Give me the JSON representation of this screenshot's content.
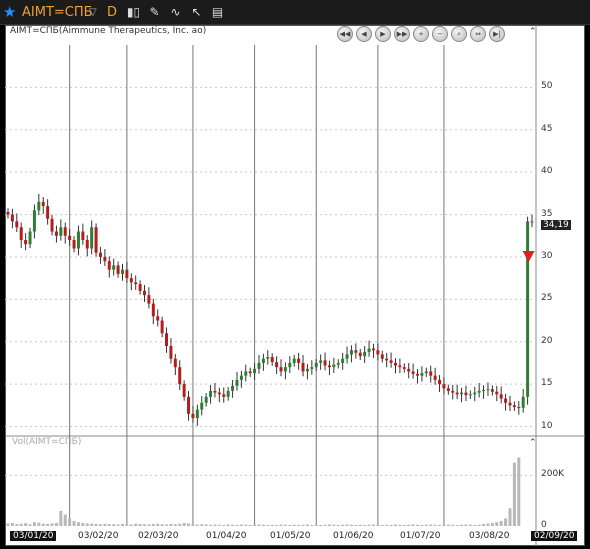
{
  "toolbar": {
    "symbol": "AIMT=СПБ",
    "period": "D",
    "icons": [
      "star-icon",
      "chevron-down-icon",
      "candles-icon",
      "pencil-icon",
      "indicator-icon",
      "cursor-icon",
      "layout-icon"
    ]
  },
  "chart_title": "AIMT=СПБ(Aimmune Therapeutics, Inc. ao)",
  "volume_title": "Vol(AIMT=СПБ)",
  "nav_buttons": [
    "first",
    "prev",
    "play",
    "next",
    "zoom-in",
    "zoom-out",
    "zoom-fit",
    "reset",
    "scroll-end"
  ],
  "chart_data": [
    {
      "type": "candlestick",
      "title": "AIMT=СПБ(Aimmune Therapeutics, Inc. ao)",
      "xlabel": "",
      "ylabel": "",
      "ylim": [
        9,
        55
      ],
      "yticks": [
        10,
        15,
        20,
        25,
        30,
        35,
        40,
        45,
        50
      ],
      "x_tick_labels": [
        "03/01/20",
        "03/02/20",
        "02/03/20",
        "01/04/20",
        "01/05/20",
        "01/06/20",
        "01/07/20",
        "03/08/20",
        "02/09/20"
      ],
      "last_price": "34,19",
      "closes": [
        35.0,
        34.2,
        33.5,
        32.0,
        31.5,
        33.0,
        35.5,
        36.5,
        36.0,
        34.5,
        33.0,
        32.5,
        33.5,
        32.5,
        32.0,
        31.0,
        33.0,
        32.0,
        31.0,
        33.5,
        30.5,
        30.0,
        29.5,
        28.5,
        29.0,
        28.0,
        28.5,
        27.5,
        27.0,
        26.8,
        26.0,
        25.5,
        24.5,
        23.0,
        22.5,
        21.0,
        19.5,
        18.0,
        17.0,
        15.0,
        13.5,
        11.5,
        11.0,
        12.0,
        12.8,
        13.5,
        14.2,
        14.0,
        13.8,
        13.5,
        14.2,
        14.8,
        15.5,
        16.0,
        16.5,
        16.3,
        16.8,
        17.5,
        18.0,
        18.2,
        17.6,
        17.0,
        16.5,
        17.0,
        17.5,
        18.0,
        17.5,
        16.5,
        16.8,
        17.0,
        17.5,
        17.8,
        17.2,
        17.0,
        17.3,
        17.5,
        18.0,
        18.5,
        19.0,
        18.7,
        18.3,
        18.8,
        19.2,
        19.0,
        18.5,
        18.0,
        17.8,
        17.5,
        17.2,
        17.0,
        16.8,
        16.5,
        16.2,
        16.0,
        16.3,
        16.5,
        16.0,
        15.5,
        15.0,
        14.5,
        14.2,
        14.0,
        13.8,
        14.0,
        13.7,
        13.8,
        14.0,
        14.2,
        14.3,
        14.4,
        14.1,
        13.8,
        13.3,
        12.8,
        12.5,
        12.3,
        12.2,
        13.5,
        34.19,
        34.19
      ],
      "volume": {
        "title": "Vol(AIMT=СПБ)",
        "ylim": [
          0,
          300000
        ],
        "yticks": [
          0,
          200000
        ],
        "ytick_labels": [
          "0",
          "200K"
        ],
        "values": [
          10000,
          12000,
          8000,
          9000,
          11000,
          7000,
          15000,
          13000,
          9000,
          8000,
          10000,
          12000,
          60000,
          45000,
          30000,
          20000,
          15000,
          12000,
          10000,
          9000,
          8000,
          7000,
          9000,
          8000,
          7000,
          6000,
          8000,
          7000,
          6000,
          9000,
          8000,
          7000,
          6000,
          8000,
          9000,
          7000,
          6000,
          8000,
          7000,
          9000,
          12000,
          10000,
          8000,
          6000,
          7000,
          6000,
          5000,
          6000,
          5000,
          4000,
          6000,
          5000,
          4000,
          6000,
          5000,
          4000,
          5000,
          6000,
          5000,
          4000,
          5000,
          4000,
          6000,
          5000,
          4000,
          5000,
          4000,
          5000,
          6000,
          4000,
          5000,
          4000,
          5000,
          6000,
          5000,
          4000,
          5000,
          6000,
          5000,
          4000,
          5000,
          4000,
          5000,
          6000,
          5000,
          4000,
          5000,
          4000,
          6000,
          5000,
          4000,
          5000,
          6000,
          5000,
          4000,
          5000,
          6000,
          5000,
          4000,
          5000,
          6000,
          5000,
          4000,
          5000,
          6000,
          5000,
          4000,
          5000,
          8000,
          10000,
          12000,
          15000,
          20000,
          30000,
          70000,
          250000,
          270000
        ]
      }
    }
  ],
  "colors": {
    "up": "#2e7d32",
    "down": "#b71c1c",
    "grid": "#c8c8c8",
    "signal": "#e02020"
  }
}
